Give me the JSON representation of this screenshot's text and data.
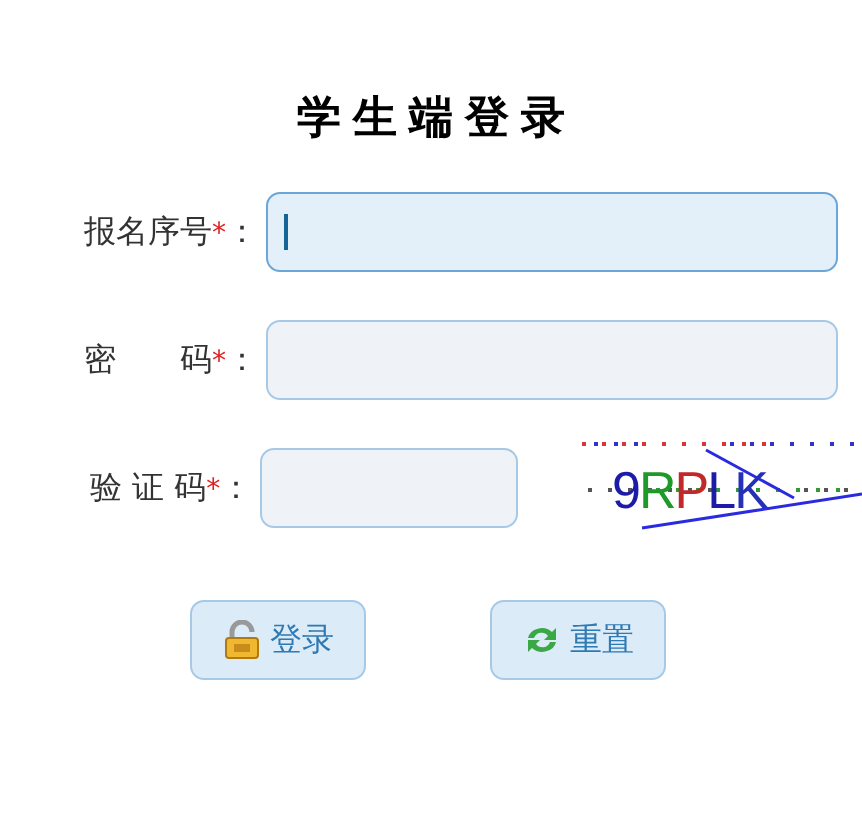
{
  "title": "学生端登录",
  "fields": [
    {
      "label": "报名序号",
      "required": "*",
      "colon": "：",
      "focused": true,
      "kind": "wide"
    },
    {
      "label": "密　　码",
      "required": "*",
      "colon": "：",
      "focused": false,
      "kind": "wide"
    },
    {
      "label": "验 证 码",
      "required": "*",
      "colon": "：",
      "focused": false,
      "kind": "captcha"
    }
  ],
  "captcha": [
    {
      "char": "9",
      "color": "#1c1ca8"
    },
    {
      "char": "R",
      "color": "#1f9a2a"
    },
    {
      "char": "P",
      "color": "#c0282a"
    },
    {
      "char": "L",
      "color": "#1c1ca8"
    },
    {
      "char": "K",
      "color": "#2430b8"
    }
  ],
  "buttons": [
    {
      "label": "登录",
      "kind": "login"
    },
    {
      "label": "重置",
      "kind": "reset"
    }
  ]
}
